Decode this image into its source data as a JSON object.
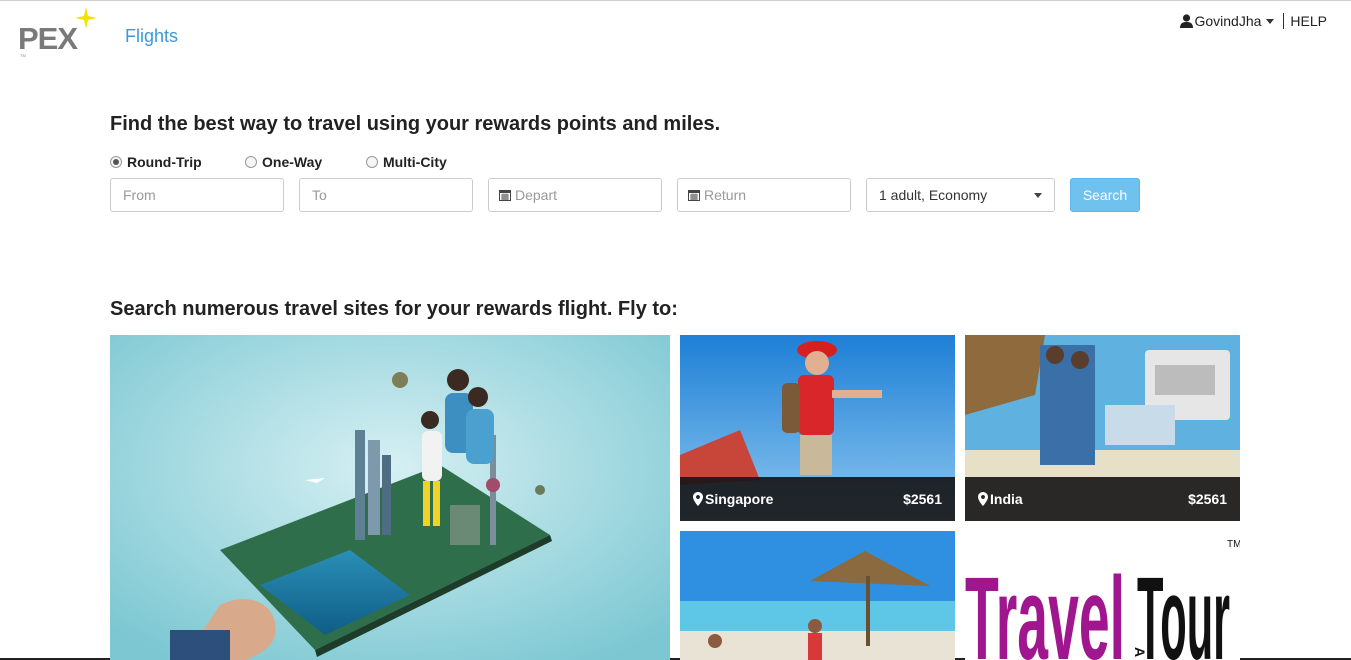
{
  "header": {
    "logo_text": "PEX",
    "nav_flights": "Flights",
    "user_name": "GovindJha",
    "help": "HELP"
  },
  "search": {
    "headline": "Find the best way to travel using your rewards points and miles.",
    "trip_types": [
      {
        "label": "Round-Trip",
        "checked": true
      },
      {
        "label": "One-Way",
        "checked": false
      },
      {
        "label": "Multi-City",
        "checked": false
      }
    ],
    "from_placeholder": "From",
    "to_placeholder": "To",
    "depart_placeholder": "Depart",
    "return_placeholder": "Return",
    "passengers": "1 adult, Economy",
    "search_button": "Search"
  },
  "destinations": {
    "title": "Search numerous travel sites for your rewards flight. Fly to:",
    "tiles": [
      {
        "city": "Singapore",
        "price": "$2561"
      },
      {
        "city": "India",
        "price": "$2561"
      }
    ],
    "promo_text": [
      "Travel",
      "AND",
      "Tour"
    ]
  },
  "colors": {
    "accent": "#3a9ad9",
    "search_button": "#6fc2ee",
    "logo_star": "#f2e200",
    "caption_bg": "#141414",
    "promo_purple": "#a0168f"
  }
}
